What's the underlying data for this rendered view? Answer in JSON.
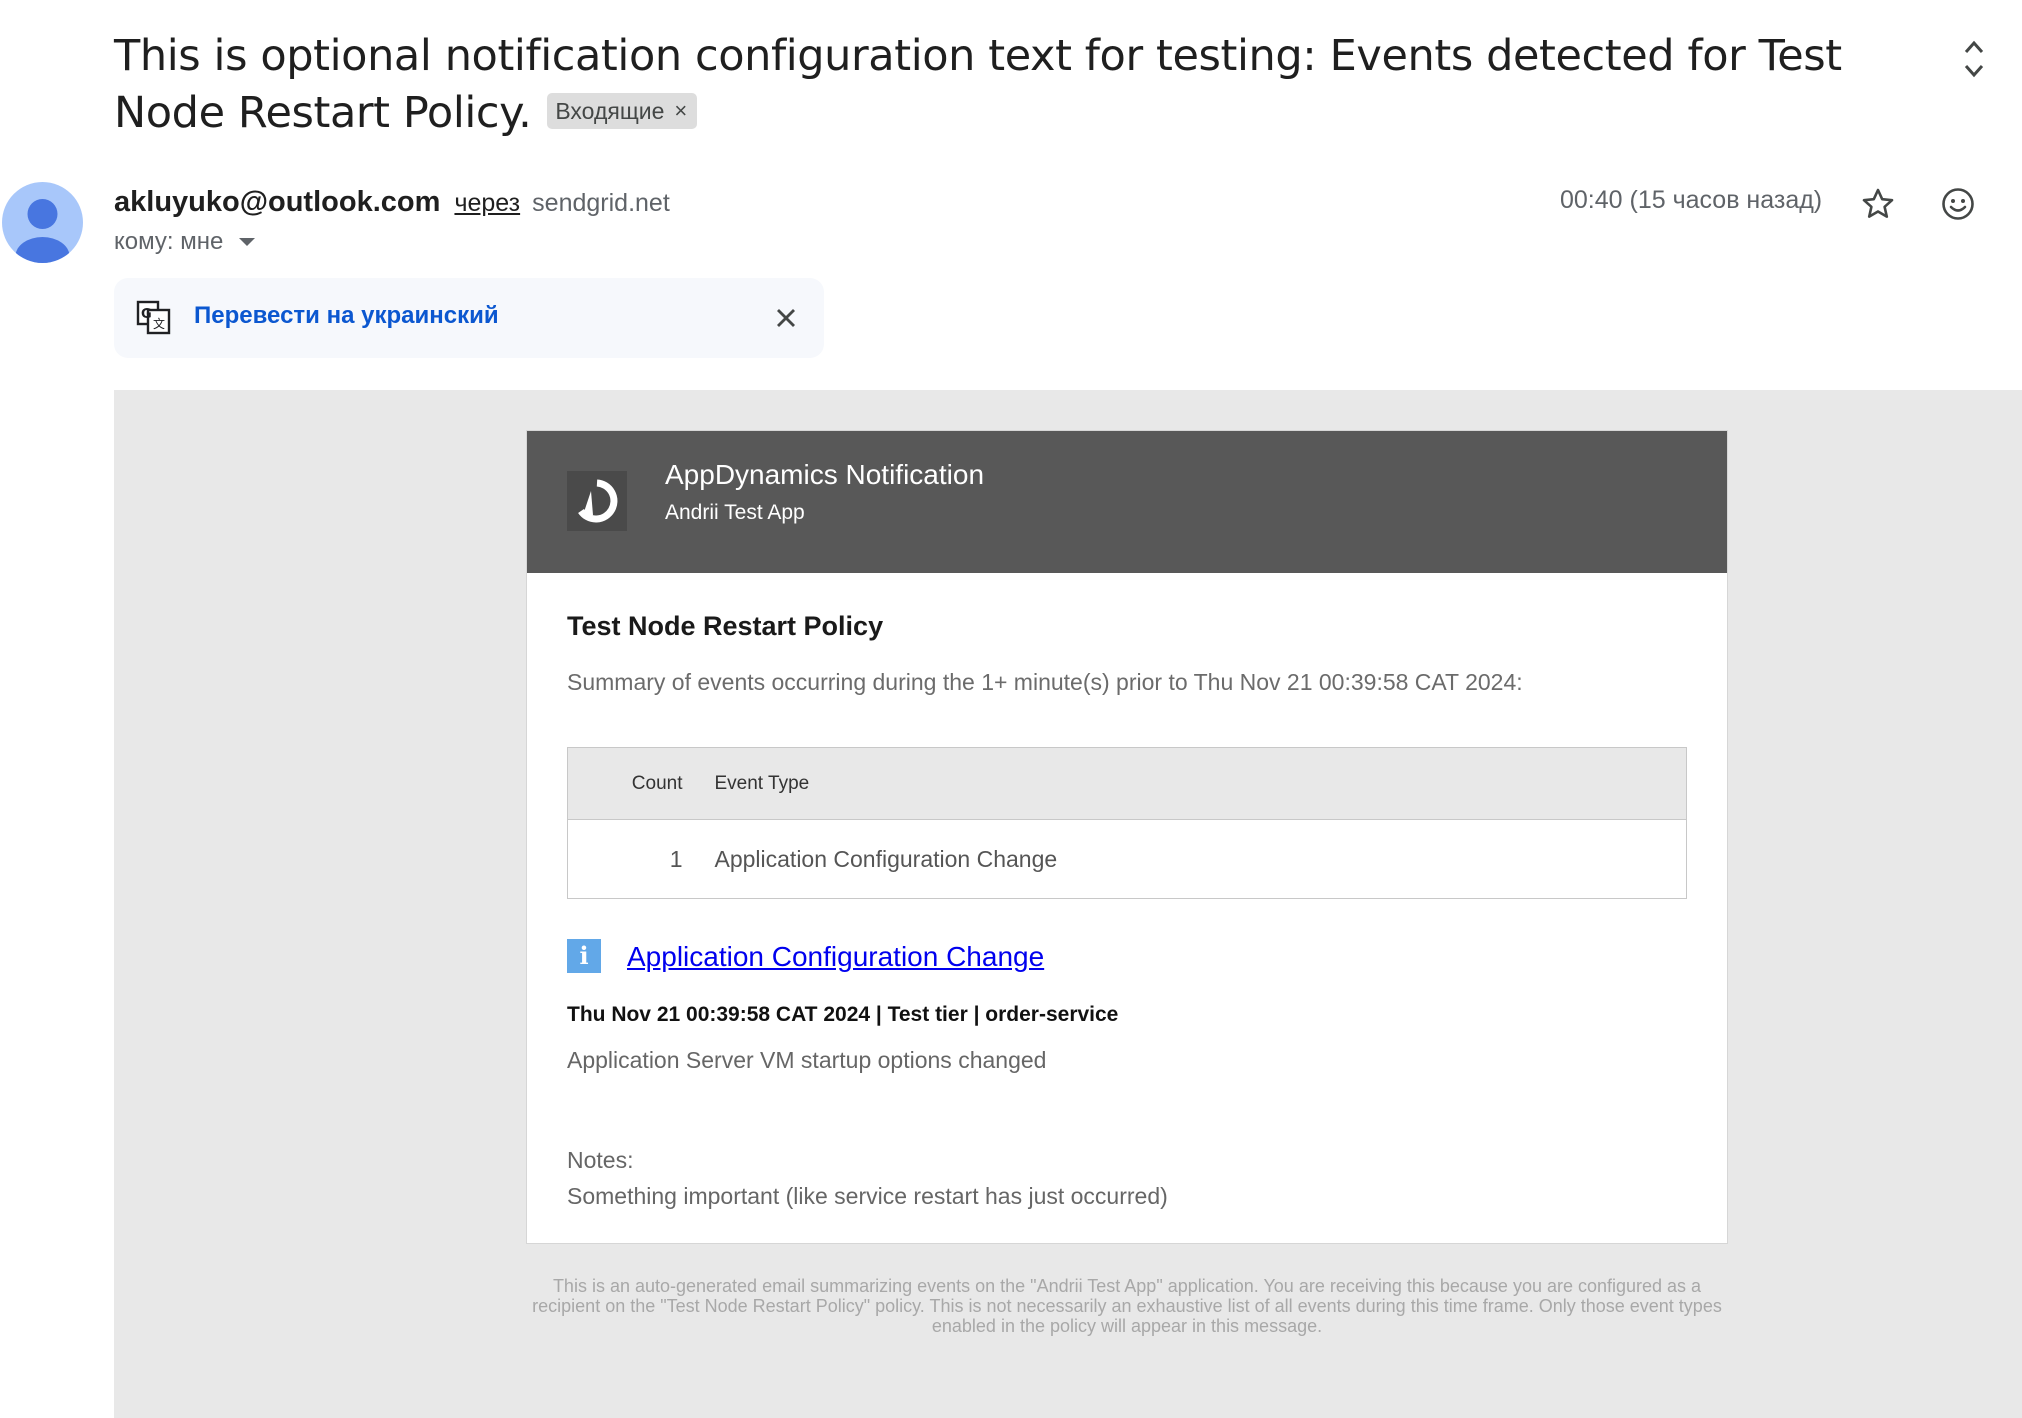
{
  "subject": {
    "text": "This is optional notification configuration text for testing: Events detected for Test Node Restart Policy.",
    "label": "Входящие",
    "label_remove": "×"
  },
  "sender": {
    "email": "akluyuko@outlook.com",
    "via": "через",
    "via_domain": "sendgrid.net",
    "to": "кому: мне",
    "timestamp": "00:40 (15 часов назад)"
  },
  "translate": {
    "link": "Перевести на украинский"
  },
  "notification": {
    "header_title": "AppDynamics Notification",
    "app_name": "Andrii Test App",
    "policy_name": "Test Node Restart Policy",
    "summary": "Summary of events occurring during the 1+ minute(s) prior to Thu Nov 21 00:39:58 CAT 2024:",
    "table": {
      "headers": [
        "Count",
        "Event Type"
      ],
      "rows": [
        {
          "count": "1",
          "event_type": "Application Configuration Change"
        }
      ]
    },
    "event_link": "Application Configuration Change",
    "event_meta": "Thu Nov 21 00:39:58 CAT 2024 | Test tier | order-service",
    "event_desc": "Application Server VM startup options changed",
    "notes_label": "Notes:",
    "notes_text": "Something important (like service restart has just occurred)"
  },
  "footer": "This is an auto-generated email summarizing events on the \"Andrii Test App\" application. You are receiving this because you are configured as a recipient on the \"Test Node Restart Policy\" policy. This is not necessarily an exhaustive list of all events during this time frame. Only those event types enabled in the policy will appear in this message.",
  "colors": {
    "link_blue": "#0b57d0",
    "header_gray": "#585858",
    "body_bg": "#e8e8e8",
    "info_blue": "#62a8e8"
  }
}
